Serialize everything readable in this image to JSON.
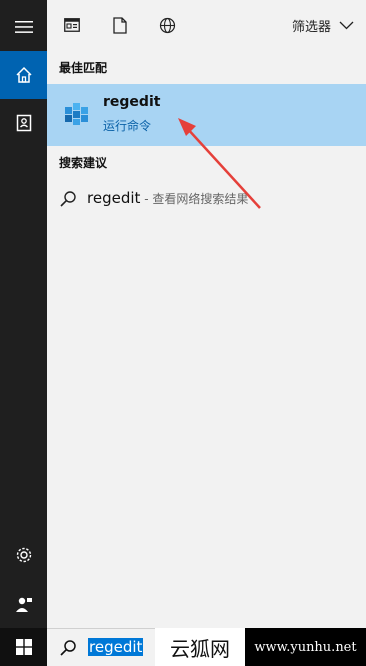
{
  "toolbar": {
    "filter_label": "筛选器",
    "icons": [
      "menu-icon",
      "apps-icon",
      "document-icon",
      "web-icon",
      "chevron-down-icon"
    ]
  },
  "sidebar": {
    "items": [
      {
        "name": "home",
        "icon": "home-icon",
        "active": true
      },
      {
        "name": "notebook",
        "icon": "notebook-icon",
        "active": false
      },
      {
        "name": "settings",
        "icon": "gear-icon",
        "active": false
      },
      {
        "name": "feedback",
        "icon": "feedback-icon",
        "active": false
      }
    ]
  },
  "best_match": {
    "section_title": "最佳匹配",
    "name": "regedit",
    "type": "运行命令",
    "icon": "regedit-icon"
  },
  "suggestions": {
    "section_title": "搜索建议",
    "items": [
      {
        "text": "regedit",
        "subtext": " - 查看网络搜索结果",
        "icon": "search-icon"
      }
    ]
  },
  "taskbar": {
    "search_value": "regedit",
    "start_icon": "windows-logo-icon"
  },
  "watermark": {
    "left": "云狐网",
    "right": "www.yunhu.net"
  },
  "colors": {
    "rail": "#1f1f1f",
    "active": "#0063b1",
    "selection": "#a8d4f3",
    "accent_text": "#0b62a8",
    "arrow": "#e5403a"
  }
}
